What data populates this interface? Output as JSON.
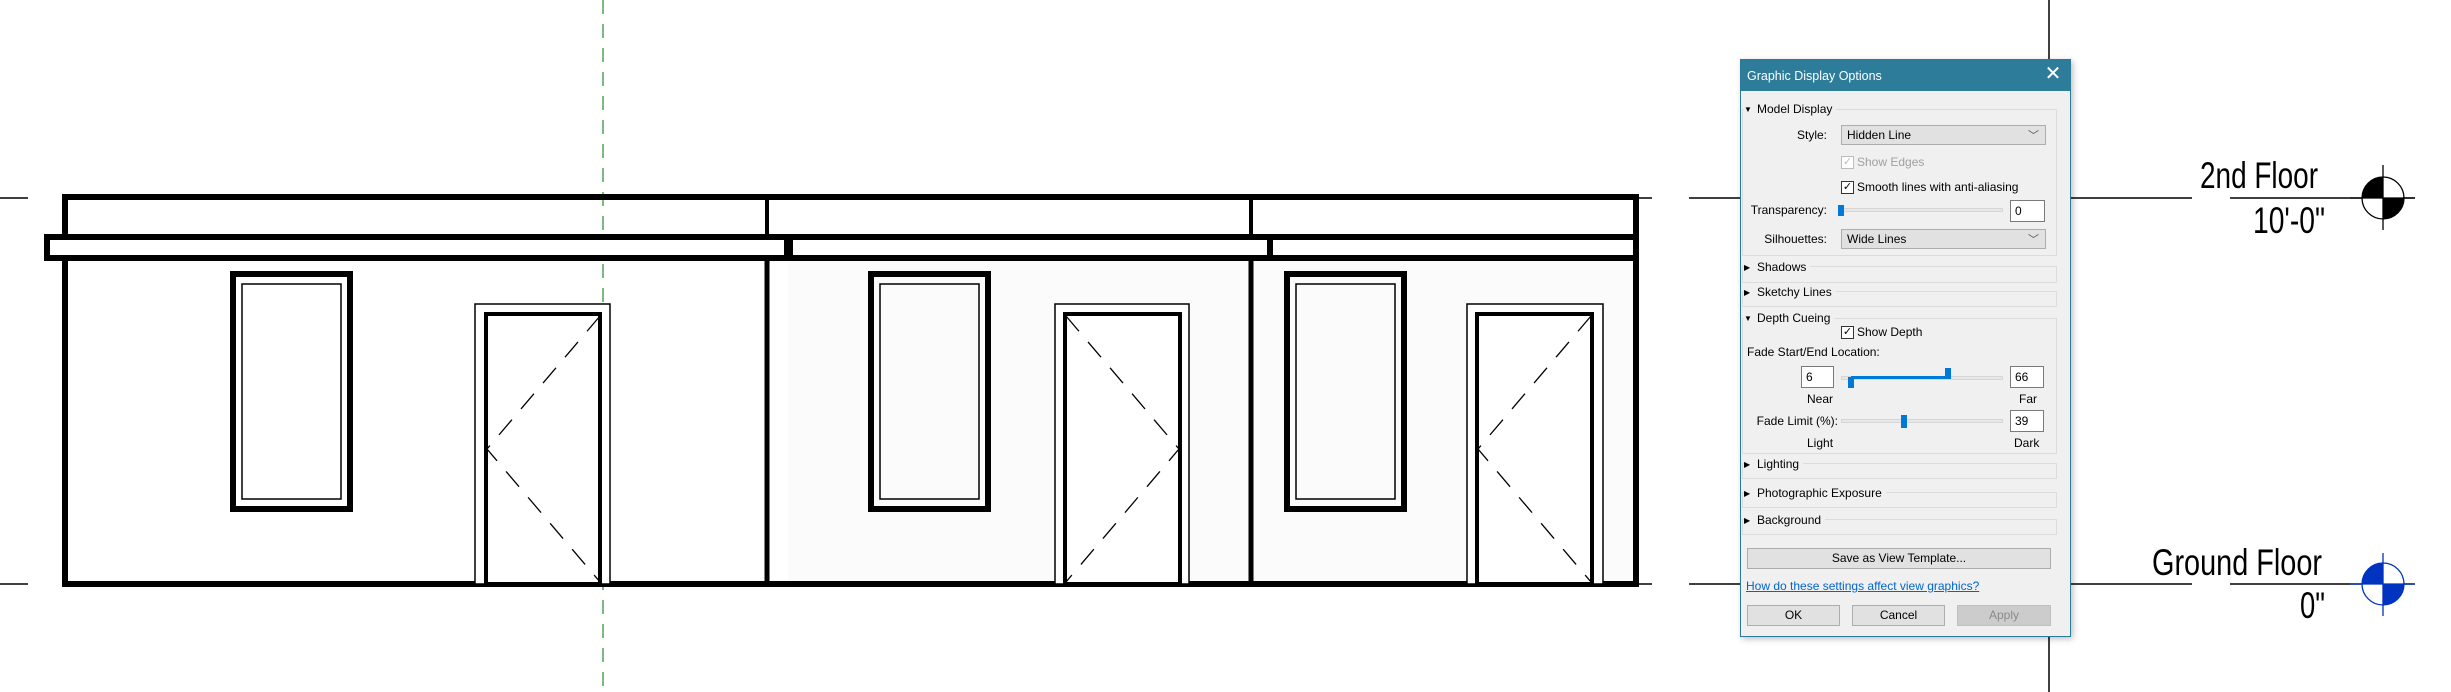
{
  "levels": [
    {
      "name": "2nd Floor",
      "elevation": "10'-0\"",
      "marker_color": "#000000"
    },
    {
      "name": "Ground Floor",
      "elevation": "0\"",
      "marker_color": "#0033c0"
    }
  ],
  "dialog": {
    "title": "Graphic Display Options",
    "close_icon": "close-icon",
    "model_display": {
      "header": "Model Display",
      "expanded": true,
      "style_label": "Style:",
      "style_value": "Hidden Line",
      "show_edges": {
        "label": "Show Edges",
        "checked": true,
        "disabled": true
      },
      "smooth_lines": {
        "label": "Smooth lines with anti-aliasing",
        "checked": true
      },
      "transparency_label": "Transparency:",
      "transparency_value": "0",
      "silhouettes_label": "Silhouettes:",
      "silhouettes_value": "Wide Lines"
    },
    "shadows": "Shadows",
    "sketchy_lines": "Sketchy Lines",
    "depth_cueing": {
      "header": "Depth Cueing",
      "expanded": true,
      "show_depth": {
        "label": "Show Depth",
        "checked": true
      },
      "fade_label": "Fade Start/End Location:",
      "near_value": "6",
      "far_value": "66",
      "near_label": "Near",
      "far_label": "Far",
      "fade_limit_label": "Fade Limit (%):",
      "fade_limit_value": "39",
      "light_label": "Light",
      "dark_label": "Dark"
    },
    "lighting": "Lighting",
    "photographic_exposure": "Photographic Exposure",
    "background": "Background",
    "save_template": "Save as View Template...",
    "help_link": "How do these settings affect view graphics?",
    "ok": "OK",
    "cancel": "Cancel",
    "apply": "Apply",
    "accent_color": "#0078d7",
    "titlebar_color": "#2d7c9a"
  }
}
